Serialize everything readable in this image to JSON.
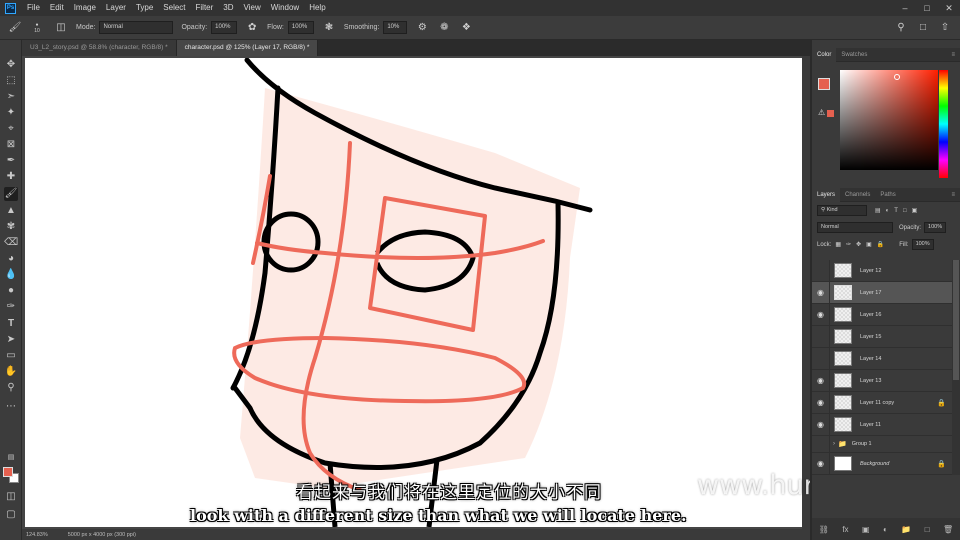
{
  "menu": {
    "logo": "Ps",
    "items": [
      "File",
      "Edit",
      "Image",
      "Layer",
      "Type",
      "Select",
      "Filter",
      "3D",
      "View",
      "Window",
      "Help"
    ]
  },
  "options": {
    "brush_size": "10",
    "mode_label": "Mode:",
    "mode_value": "Normal",
    "opacity_label": "Opacity:",
    "opacity_value": "100%",
    "flow_label": "Flow:",
    "flow_value": "100%",
    "smoothing_label": "Smoothing:",
    "smoothing_value": "10%"
  },
  "tabs": [
    {
      "label": "U3_L2_story.psd @ 58.8% (character, RGB/8) *"
    },
    {
      "label": "character.psd @ 125% (Layer 17, RGB/8) *"
    }
  ],
  "status": {
    "zoom": "124.83%",
    "doc_size": "5000 px x 4000 px (300 ppi)"
  },
  "subtitles": {
    "chinese": "看起来与我们将在这里定位的大小不同",
    "english": "look with a different size than what we will locate here."
  },
  "watermark": "www.hunls.com",
  "color_panel": {
    "tabs": [
      "Color",
      "Swatches"
    ],
    "fg_color": "#e5604f",
    "bg_color": "#ffffff"
  },
  "layers_panel": {
    "tabs": [
      "Layers",
      "Channels",
      "Paths"
    ],
    "filter_label": "Kind",
    "blend_mode": "Normal",
    "opacity_label": "Opacity:",
    "opacity_value": "100%",
    "lock_label": "Lock:",
    "fill_label": "Fill:",
    "fill_value": "100%",
    "layers": [
      {
        "name": "Layer 12",
        "visible": false
      },
      {
        "name": "Layer 17",
        "visible": true,
        "selected": true
      },
      {
        "name": "Layer 16",
        "visible": true
      },
      {
        "name": "Layer 15",
        "visible": false
      },
      {
        "name": "Layer 14",
        "visible": false
      },
      {
        "name": "Layer 13",
        "visible": true
      },
      {
        "name": "Layer 11 copy",
        "visible": true,
        "locked": true
      },
      {
        "name": "Layer 11",
        "visible": true
      },
      {
        "name": "Group 1",
        "visible": false,
        "group": true
      },
      {
        "name": "Background",
        "visible": true,
        "locked": true,
        "italic": true
      }
    ]
  },
  "accent_color": "#e5604f"
}
